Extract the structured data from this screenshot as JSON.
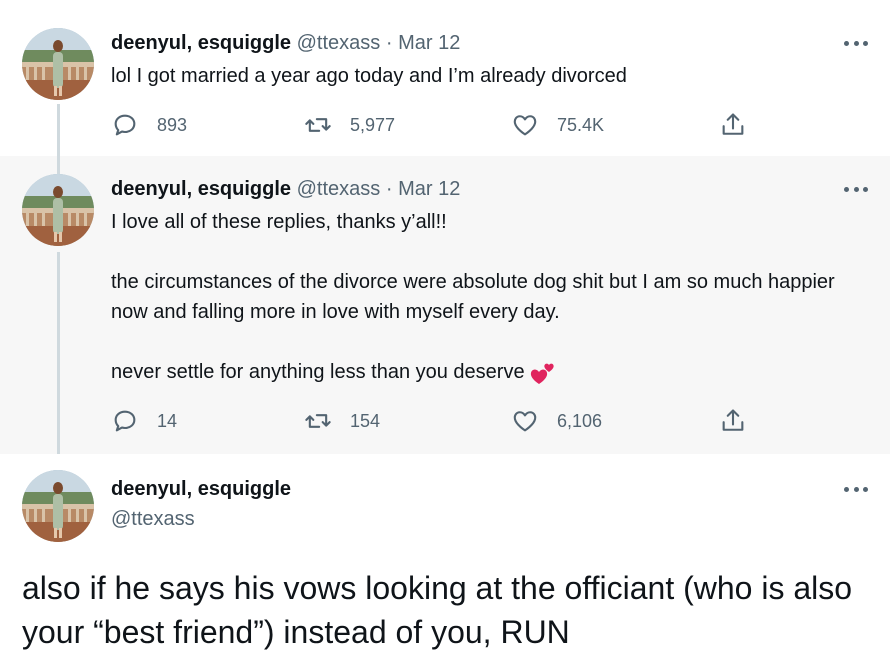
{
  "colors": {
    "text": "#0f1419",
    "secondary": "#536471",
    "thread_line": "#cfd9de",
    "highlight_bg": "#f7f7f7"
  },
  "tweets": [
    {
      "name": "deenyul, esquiggle",
      "handle": "@ttexass",
      "dot": "·",
      "date": "Mar 12",
      "text": "lol I got married a year ago today and I’m already divorced",
      "replies": "893",
      "retweets": "5,977",
      "likes": "75.4K"
    },
    {
      "name": "deenyul, esquiggle",
      "handle": "@ttexass",
      "dot": "·",
      "date": "Mar 12",
      "paragraphs": [
        "I love all of these replies, thanks y’all!!",
        "the circumstances of the divorce were absolute dog shit but I am so much happier now and falling more in love with myself every day.",
        "never settle for anything less than you deserve"
      ],
      "emoji": "two-hearts-icon",
      "replies": "14",
      "retweets": "154",
      "likes": "6,106"
    },
    {
      "name": "deenyul, esquiggle",
      "handle": "@ttexass",
      "text": "also if he says his vows looking at the officiant (who is also your “best friend”) instead of you, RUN"
    }
  ]
}
